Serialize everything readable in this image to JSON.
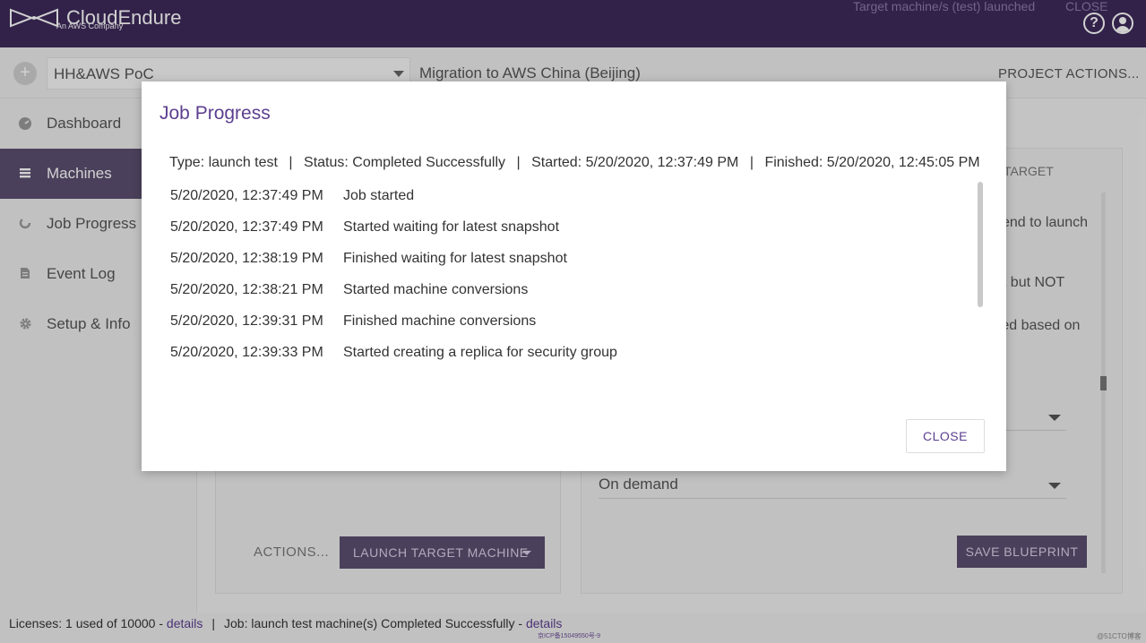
{
  "header": {
    "brand": "CloudEndure",
    "brand_sub": "An AWS Company",
    "notice": "Target machine/s (test) launched",
    "close_label": "CLOSE",
    "help_symbol": "?"
  },
  "project_bar": {
    "project_name": "HH&AWS PoC",
    "target": "Migration to AWS China (Beijing)",
    "actions_label": "PROJECT ACTIONS...",
    "add_symbol": "+"
  },
  "sidebar": {
    "items": [
      {
        "label": "Dashboard",
        "icon": "gauge-icon"
      },
      {
        "label": "Machines",
        "icon": "list-icon",
        "active": true
      },
      {
        "label": "Job Progress",
        "icon": "spinner-icon"
      },
      {
        "label": "Event Log",
        "icon": "document-icon"
      },
      {
        "label": "Setup & Info",
        "icon": "gear-icon"
      }
    ]
  },
  "background": {
    "tab_label": "TARGET",
    "text1": "end to launch",
    "text2": "nt but NOT",
    "text3": "ated based on",
    "select2_value": "On demand",
    "actions_label": "ACTIONS...",
    "launch_label": "LAUNCH TARGET MACHINE",
    "save_label": "SAVE BLUEPRINT"
  },
  "modal": {
    "title": "Job Progress",
    "type": "Type: launch test",
    "status": "Status: Completed Successfully",
    "started": "Started: 5/20/2020, 12:37:49 PM",
    "finished": "Finished: 5/20/2020, 12:45:05 PM",
    "separator": "|",
    "log": [
      {
        "time": "5/20/2020, 12:37:49 PM",
        "message": "Job started"
      },
      {
        "time": "5/20/2020, 12:37:49 PM",
        "message": "Started waiting for latest snapshot"
      },
      {
        "time": "5/20/2020, 12:38:19 PM",
        "message": "Finished waiting for latest snapshot"
      },
      {
        "time": "5/20/2020, 12:38:21 PM",
        "message": "Started machine conversions"
      },
      {
        "time": "5/20/2020, 12:39:31 PM",
        "message": "Finished machine conversions"
      },
      {
        "time": "5/20/2020, 12:39:33 PM",
        "message": "Started creating a replica for security group"
      }
    ],
    "close_label": "CLOSE"
  },
  "footer": {
    "licenses_prefix": "Licenses:  1 used of 10000 - ",
    "details1": "details",
    "separator": "|",
    "job_prefix": "Job:  launch test machine(s) Completed Successfully - ",
    "details2": "details",
    "icp": "京ICP备15049550号-9",
    "watermark": "@51CTO博客"
  }
}
